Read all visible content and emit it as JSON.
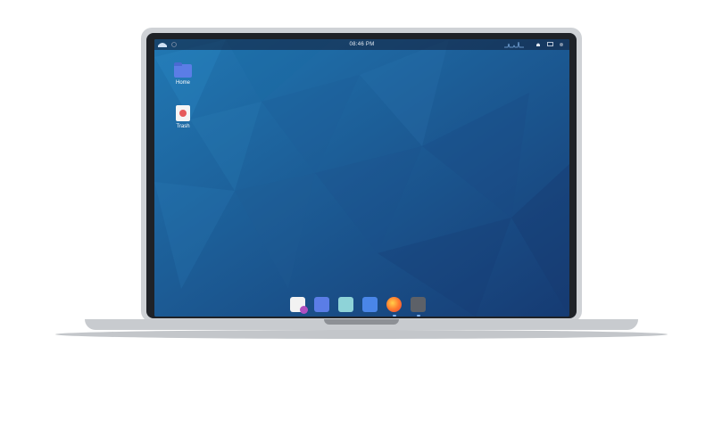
{
  "topbar": {
    "clock": "08:46 PM"
  },
  "desktop": {
    "icons": [
      {
        "label": "Home",
        "icon": "folder-icon"
      },
      {
        "label": "Trash",
        "icon": "trash-icon"
      }
    ]
  },
  "dock": {
    "items": [
      {
        "icon": "document-editor-icon"
      },
      {
        "icon": "files-icon"
      },
      {
        "icon": "video-player-icon"
      },
      {
        "icon": "app-store-icon"
      },
      {
        "icon": "firefox-icon"
      },
      {
        "icon": "terminal-icon"
      }
    ]
  }
}
